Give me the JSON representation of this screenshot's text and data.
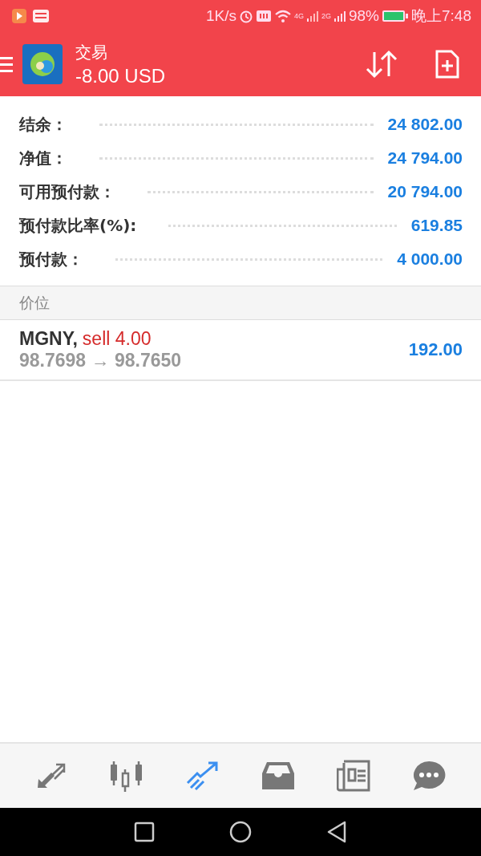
{
  "status_bar": {
    "speed": "1K/s",
    "network_1": "4G",
    "network_2": "2G",
    "battery": "98%",
    "time": "晚上7:48"
  },
  "header": {
    "title": "交易",
    "balance": "-8.00 USD"
  },
  "summary": [
    {
      "label": "结余：",
      "value": "24 802.00"
    },
    {
      "label": "净值：",
      "value": "24 794.00"
    },
    {
      "label": "可用预付款：",
      "value": "20 794.00"
    },
    {
      "label": "预付款比率(%):",
      "value": "619.85"
    },
    {
      "label": "预付款：",
      "value": "4 000.00"
    }
  ],
  "section": {
    "title": "价位"
  },
  "positions": [
    {
      "symbol": "MGNY,",
      "side": "sell 4.00",
      "prices": "98.7698 → 98.7650",
      "profit": "192.00"
    }
  ],
  "bottom_nav": [
    {
      "kind": "quotes",
      "selected": false
    },
    {
      "kind": "chart",
      "selected": false
    },
    {
      "kind": "trade",
      "selected": true
    },
    {
      "kind": "history",
      "selected": false
    },
    {
      "kind": "news",
      "selected": false
    },
    {
      "kind": "messages",
      "selected": false
    }
  ]
}
